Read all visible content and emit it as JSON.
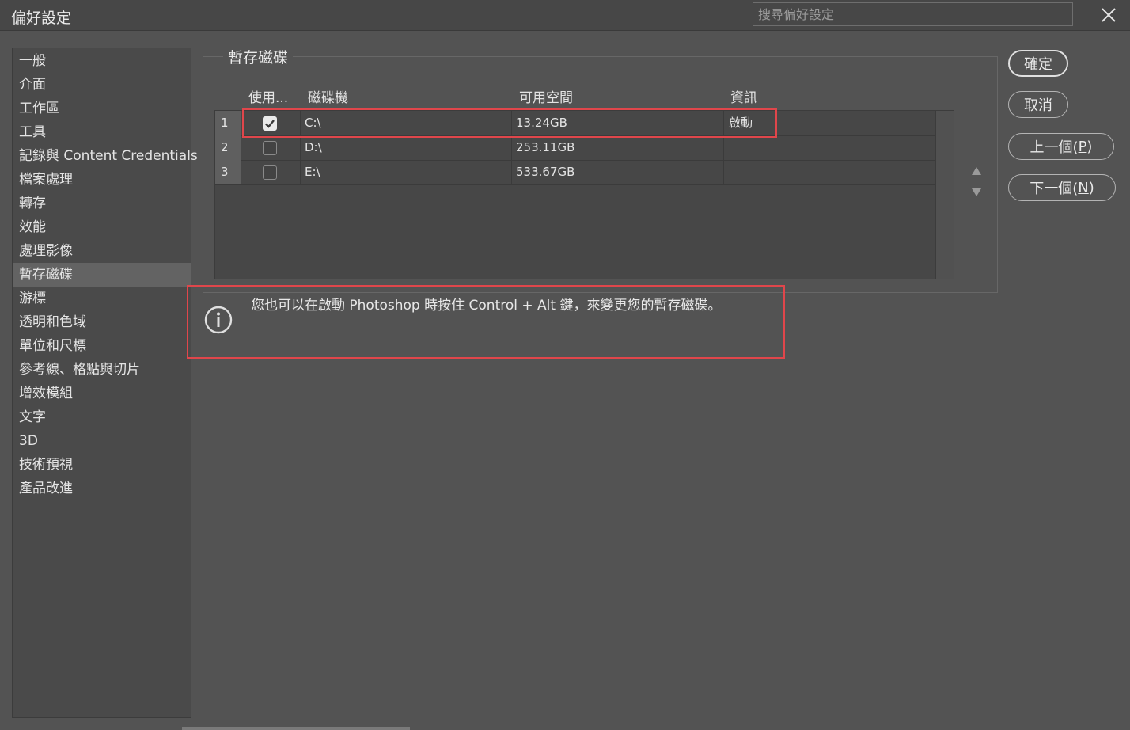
{
  "window": {
    "title": "偏好設定",
    "search_placeholder": "搜尋偏好設定"
  },
  "sidebar": {
    "items": [
      {
        "label": "一般"
      },
      {
        "label": "介面"
      },
      {
        "label": "工作區"
      },
      {
        "label": "工具"
      },
      {
        "label": "記錄與 Content Credentials"
      },
      {
        "label": "檔案處理"
      },
      {
        "label": "轉存"
      },
      {
        "label": "效能"
      },
      {
        "label": "處理影像"
      },
      {
        "label": "暫存磁碟",
        "active": true
      },
      {
        "label": "游標"
      },
      {
        "label": "透明和色域"
      },
      {
        "label": "單位和尺標"
      },
      {
        "label": "參考線、格點與切片"
      },
      {
        "label": "增效模組"
      },
      {
        "label": "文字"
      },
      {
        "label": "3D"
      },
      {
        "label": "技術預視"
      },
      {
        "label": "產品改進"
      }
    ]
  },
  "scratch": {
    "group_title": "暫存磁碟",
    "columns": {
      "use": "使用...",
      "drive": "磁碟機",
      "free": "可用空間",
      "info": "資訊"
    },
    "rows": [
      {
        "num": "1",
        "checked": true,
        "drive": "C:\\",
        "free": "13.24GB",
        "info": "啟動"
      },
      {
        "num": "2",
        "checked": false,
        "drive": "D:\\",
        "free": "253.11GB",
        "info": ""
      },
      {
        "num": "3",
        "checked": false,
        "drive": "E:\\",
        "free": "533.67GB",
        "info": ""
      }
    ]
  },
  "info_message": "您也可以在啟動 Photoshop 時按住 Control + Alt 鍵，來變更您的暫存磁碟。",
  "buttons": {
    "ok": "確定",
    "cancel": "取消",
    "prev_text": "上一個(",
    "prev_key": "P",
    "next_text": "下一個(",
    "next_key": "N",
    "close_paren": ")"
  },
  "colors": {
    "highlight": "#e0464b",
    "background": "#535353"
  },
  "icons": {
    "close": "close-icon",
    "info": "info-icon",
    "move_up": "triangle-up-icon",
    "move_down": "triangle-down-icon",
    "check": "checkmark-icon"
  }
}
